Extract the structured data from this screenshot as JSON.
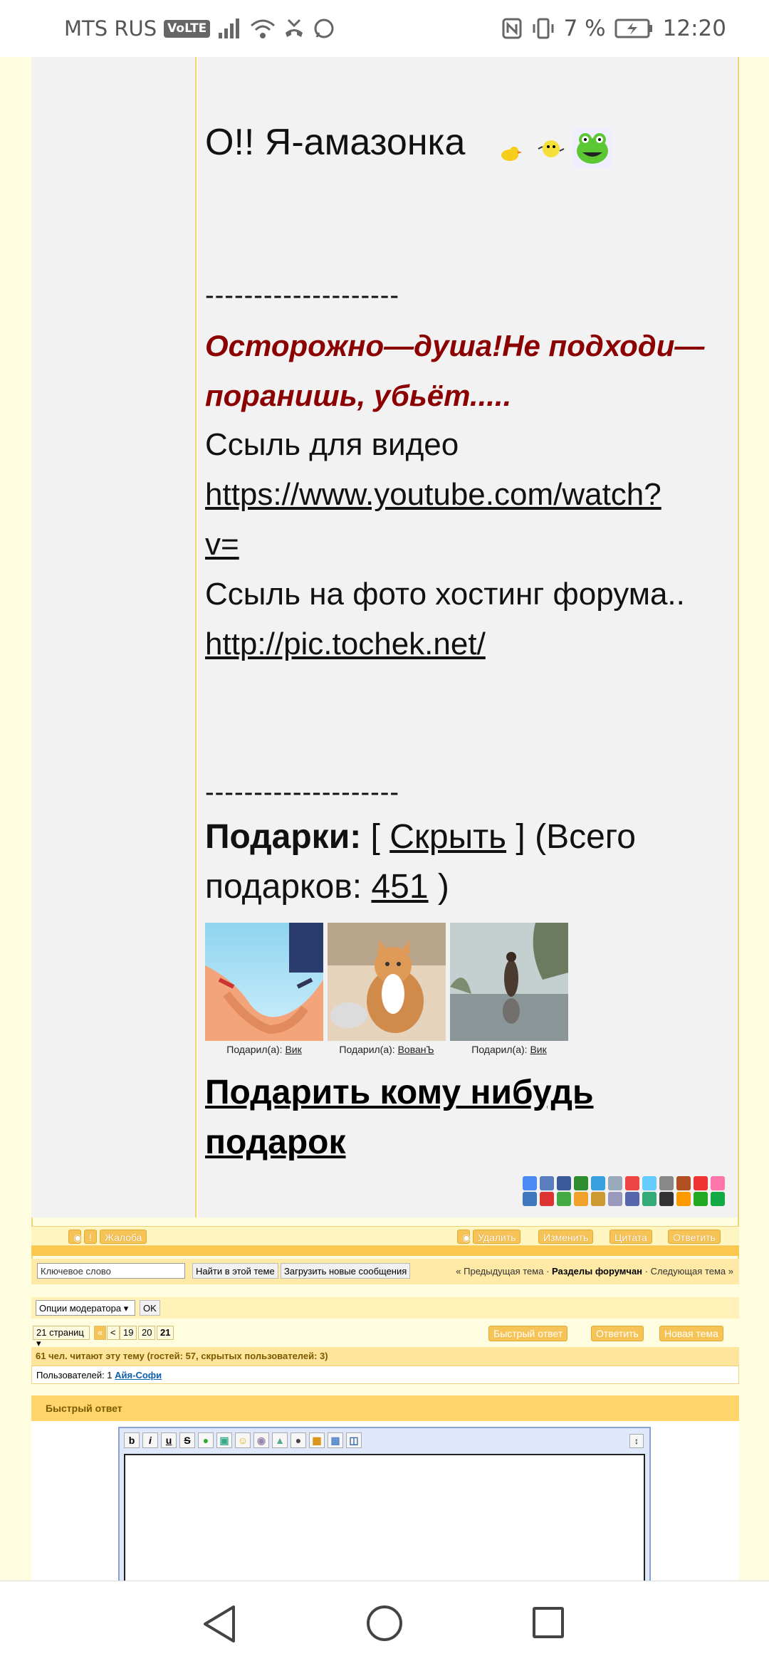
{
  "status": {
    "carrier": "MTS RUS",
    "volte": "VoLTE",
    "battery": "7 %",
    "time": "12:20"
  },
  "post": {
    "greeting": "О!! Я-амазонка",
    "divider": "--------------------",
    "quote_line1": "Осторожно—душа!Не подходи—",
    "quote_line2": "поранишь, убьёт.....",
    "video_label": "Ссыль для видео",
    "video_url_line1": "https://www.youtube.com/watch?",
    "video_url_line2": "v=",
    "photo_label": "Ссыль на фото хостинг форума..",
    "photo_url": "http://pic.tochek.net/",
    "gifts_title": "Подарки:",
    "gifts_hide": "Скрыть",
    "gifts_total_prefix": "(Всего",
    "gifts_total_label": "подарков:",
    "gifts_count": "451",
    "gifts": [
      {
        "caption": "Подарил(а):",
        "from": "Вик"
      },
      {
        "caption": "Подарил(а):",
        "from": "ВованЪ"
      },
      {
        "caption": "Подарил(а):",
        "from": "Вик"
      }
    ],
    "give_gift_line1": "Подарить кому нибудь",
    "give_gift_line2": "подарок"
  },
  "actions": {
    "complaint": "Жалоба",
    "delete": "Удалить",
    "edit": "Изменить",
    "quote": "Цитата",
    "reply": "Ответить"
  },
  "search": {
    "keyword_placeholder": "Ключевое слово",
    "find_in_topic": "Найти в этой теме",
    "load_new": "Загрузить новые сообщения"
  },
  "topic_nav": {
    "prev": "« Предыдущая тема",
    "sections": "Разделы форумчан",
    "next": "Следующая тема »"
  },
  "moderation": {
    "options": "Опции модератора",
    "ok": "OK"
  },
  "pager": {
    "pages_label": "21 страниц",
    "first": "«",
    "prev": "<",
    "pages": [
      "19",
      "20",
      "21"
    ],
    "quick_reply": "Быстрый ответ",
    "reply": "Ответить",
    "new_topic": "Новая тема"
  },
  "readers": {
    "text": "61 чел. читают эту тему (гостей: 57, скрытых пользователей: 3)",
    "users_label": "Пользователей: 1",
    "user": "Айя-Софи"
  },
  "quick_reply": {
    "title": "Быстрый ответ",
    "tools": [
      "b",
      "i",
      "u",
      "S"
    ]
  }
}
